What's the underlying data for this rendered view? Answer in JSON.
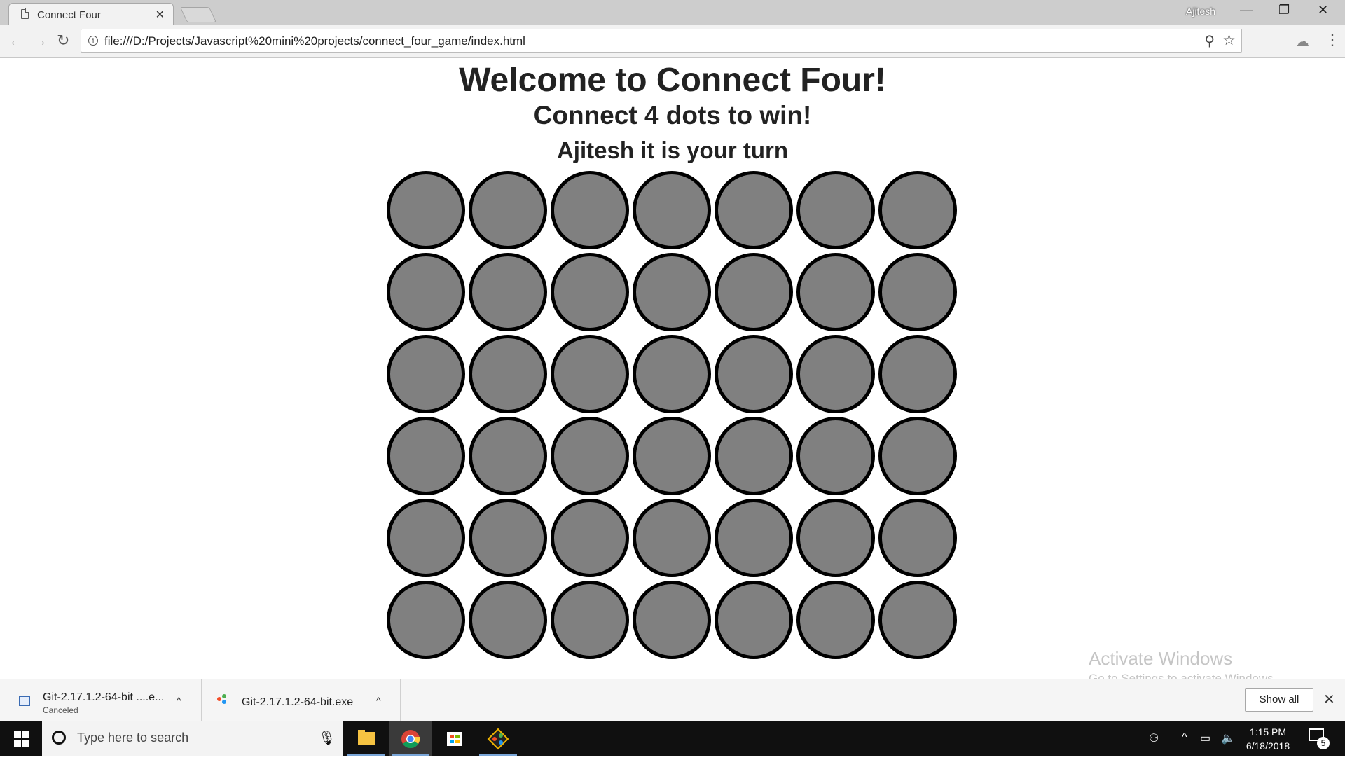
{
  "browser": {
    "tab_title": "Connect Four",
    "tab_close": "✕",
    "profile_name": "Ajitesh",
    "url": "file:///D:/Projects/Javascript%20mini%20projects/connect_four_game/index.html",
    "window_controls": {
      "minimize": "—",
      "restore": "❐",
      "close": "✕"
    },
    "nav": {
      "back": "←",
      "forward": "→",
      "reload": "↻"
    },
    "info_glyph": "i",
    "zoom_glyph": "⚲",
    "star_glyph": "☆",
    "menu_glyph": "⋮",
    "extension_glyph": "☁"
  },
  "page": {
    "title": "Welcome to Connect Four!",
    "subtitle": "Connect 4 dots to win!",
    "turn_message": "Ajitesh it is your turn",
    "board": {
      "rows": 6,
      "columns": 7,
      "empty_color": "#808080",
      "border_color": "#000000"
    }
  },
  "watermark": {
    "line1": "Activate Windows",
    "line2": "Go to Settings to activate Windows."
  },
  "downloads": {
    "items": [
      {
        "name": "Git-2.17.1.2-64-bit ....e...",
        "status": "Canceled",
        "icon": "exe-file-icon"
      },
      {
        "name": "Git-2.17.1.2-64-bit.exe",
        "status": "",
        "icon": "git-icon"
      }
    ],
    "chevron": "^",
    "show_all_label": "Show all",
    "close_glyph": "✕"
  },
  "taskbar": {
    "search_placeholder": "Type here to search",
    "time": "1:15 PM",
    "date": "6/18/2018",
    "notification_count": "5",
    "apps": [
      "file-explorer",
      "chrome",
      "store",
      "git"
    ]
  }
}
